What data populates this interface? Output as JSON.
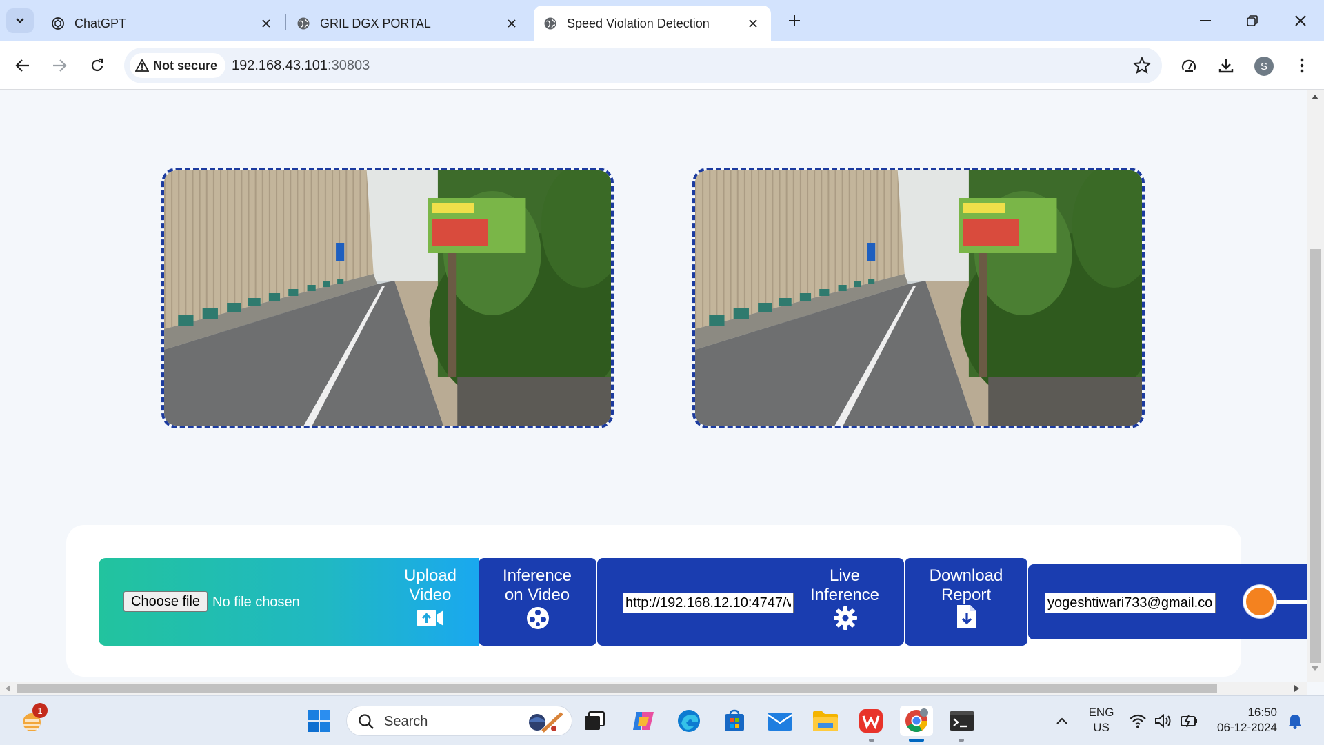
{
  "browser": {
    "tabs": [
      {
        "label": "ChatGPT",
        "active": false
      },
      {
        "label": "GRIL DGX PORTAL",
        "active": false
      },
      {
        "label": "Speed Violation Detection",
        "active": true
      }
    ],
    "security_label": "Not secure",
    "url_host": "192.168.43.101",
    "url_port": ":30803",
    "profile_initial": "S"
  },
  "page": {
    "upload": {
      "choose_file_label": "Choose file",
      "file_status": "No file chosen",
      "upload_line1": "Upload",
      "upload_line2": "Video",
      "icon": "video-upload-icon"
    },
    "inference_video": {
      "line1": "Inference",
      "line2": "on Video",
      "icon": "film-reel-icon"
    },
    "live": {
      "stream_url_value": "http://192.168.12.10:4747/v",
      "line1": "Live",
      "line2": "Inference",
      "icon": "gear-icon"
    },
    "report": {
      "line1": "Download",
      "line2": "Report",
      "icon": "file-download-icon"
    },
    "email_value": "yogeshtiwari733@gmail.com",
    "colors": {
      "frame_border": "#1c3b9f",
      "panel_blue": "#1a3db0",
      "upload_gradient_start": "#22c39e",
      "upload_gradient_end": "#1aa8ef",
      "toggle_knob": "#f4821f"
    }
  },
  "taskbar": {
    "notification_count": "1",
    "search_placeholder": "Search",
    "lang_line1": "ENG",
    "lang_line2": "US",
    "time": "16:50",
    "date": "06-12-2024"
  }
}
